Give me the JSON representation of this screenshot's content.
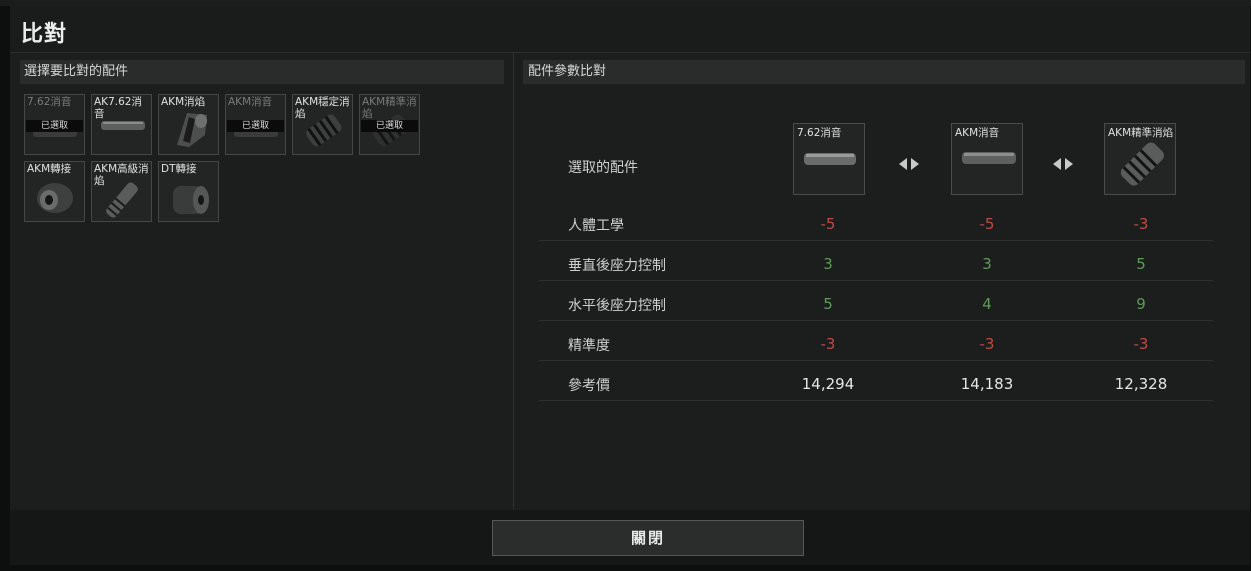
{
  "dialog": {
    "title": "比對",
    "close_label": "關閉"
  },
  "selector": {
    "heading": "選擇要比對的配件",
    "selected_badge": "已選取",
    "items": [
      {
        "name": "7.62消音",
        "selected": true,
        "icon": "suppressor-icon"
      },
      {
        "name": "AK7.62消音",
        "selected": false,
        "icon": "suppressor-icon"
      },
      {
        "name": "AKM消焰",
        "selected": false,
        "icon": "flash-hider-icon"
      },
      {
        "name": "AKM消音",
        "selected": true,
        "icon": "suppressor-icon"
      },
      {
        "name": "AKM穩定消焰",
        "selected": false,
        "icon": "compensator-icon"
      },
      {
        "name": "AKM精準消焰",
        "selected": true,
        "icon": "compensator-icon"
      },
      {
        "name": "AKM轉接",
        "selected": false,
        "icon": "muzzle-adapter-icon"
      },
      {
        "name": "AKM高級消焰",
        "selected": false,
        "icon": "flash-hider-icon"
      },
      {
        "name": "DT轉接",
        "selected": false,
        "icon": "muzzle-adapter-icon"
      }
    ]
  },
  "comparison": {
    "heading": "配件參數比對",
    "selected_label": "選取的配件",
    "columns": [
      {
        "name": "7.62消音",
        "icon": "suppressor-icon"
      },
      {
        "name": "AKM消音",
        "icon": "suppressor-icon"
      },
      {
        "name": "AKM精準消焰",
        "icon": "compensator-icon"
      }
    ],
    "rows": [
      {
        "label": "人體工學",
        "values": [
          "-5",
          "-5",
          "-3"
        ],
        "kind": [
          "neg",
          "neg",
          "neg"
        ]
      },
      {
        "label": "垂直後座力控制",
        "values": [
          "3",
          "3",
          "5"
        ],
        "kind": [
          "pos",
          "pos",
          "pos"
        ]
      },
      {
        "label": "水平後座力控制",
        "values": [
          "5",
          "4",
          "9"
        ],
        "kind": [
          "pos",
          "pos",
          "pos"
        ]
      },
      {
        "label": "精準度",
        "values": [
          "-3",
          "-3",
          "-3"
        ],
        "kind": [
          "neg",
          "neg",
          "neg"
        ]
      },
      {
        "label": "參考價",
        "values": [
          "14,294",
          "14,183",
          "12,328"
        ],
        "kind": [
          "price",
          "price",
          "price"
        ]
      }
    ]
  },
  "colors": {
    "negative": "#c04a44",
    "positive": "#5f9b58",
    "background": "#1c1d1d"
  }
}
